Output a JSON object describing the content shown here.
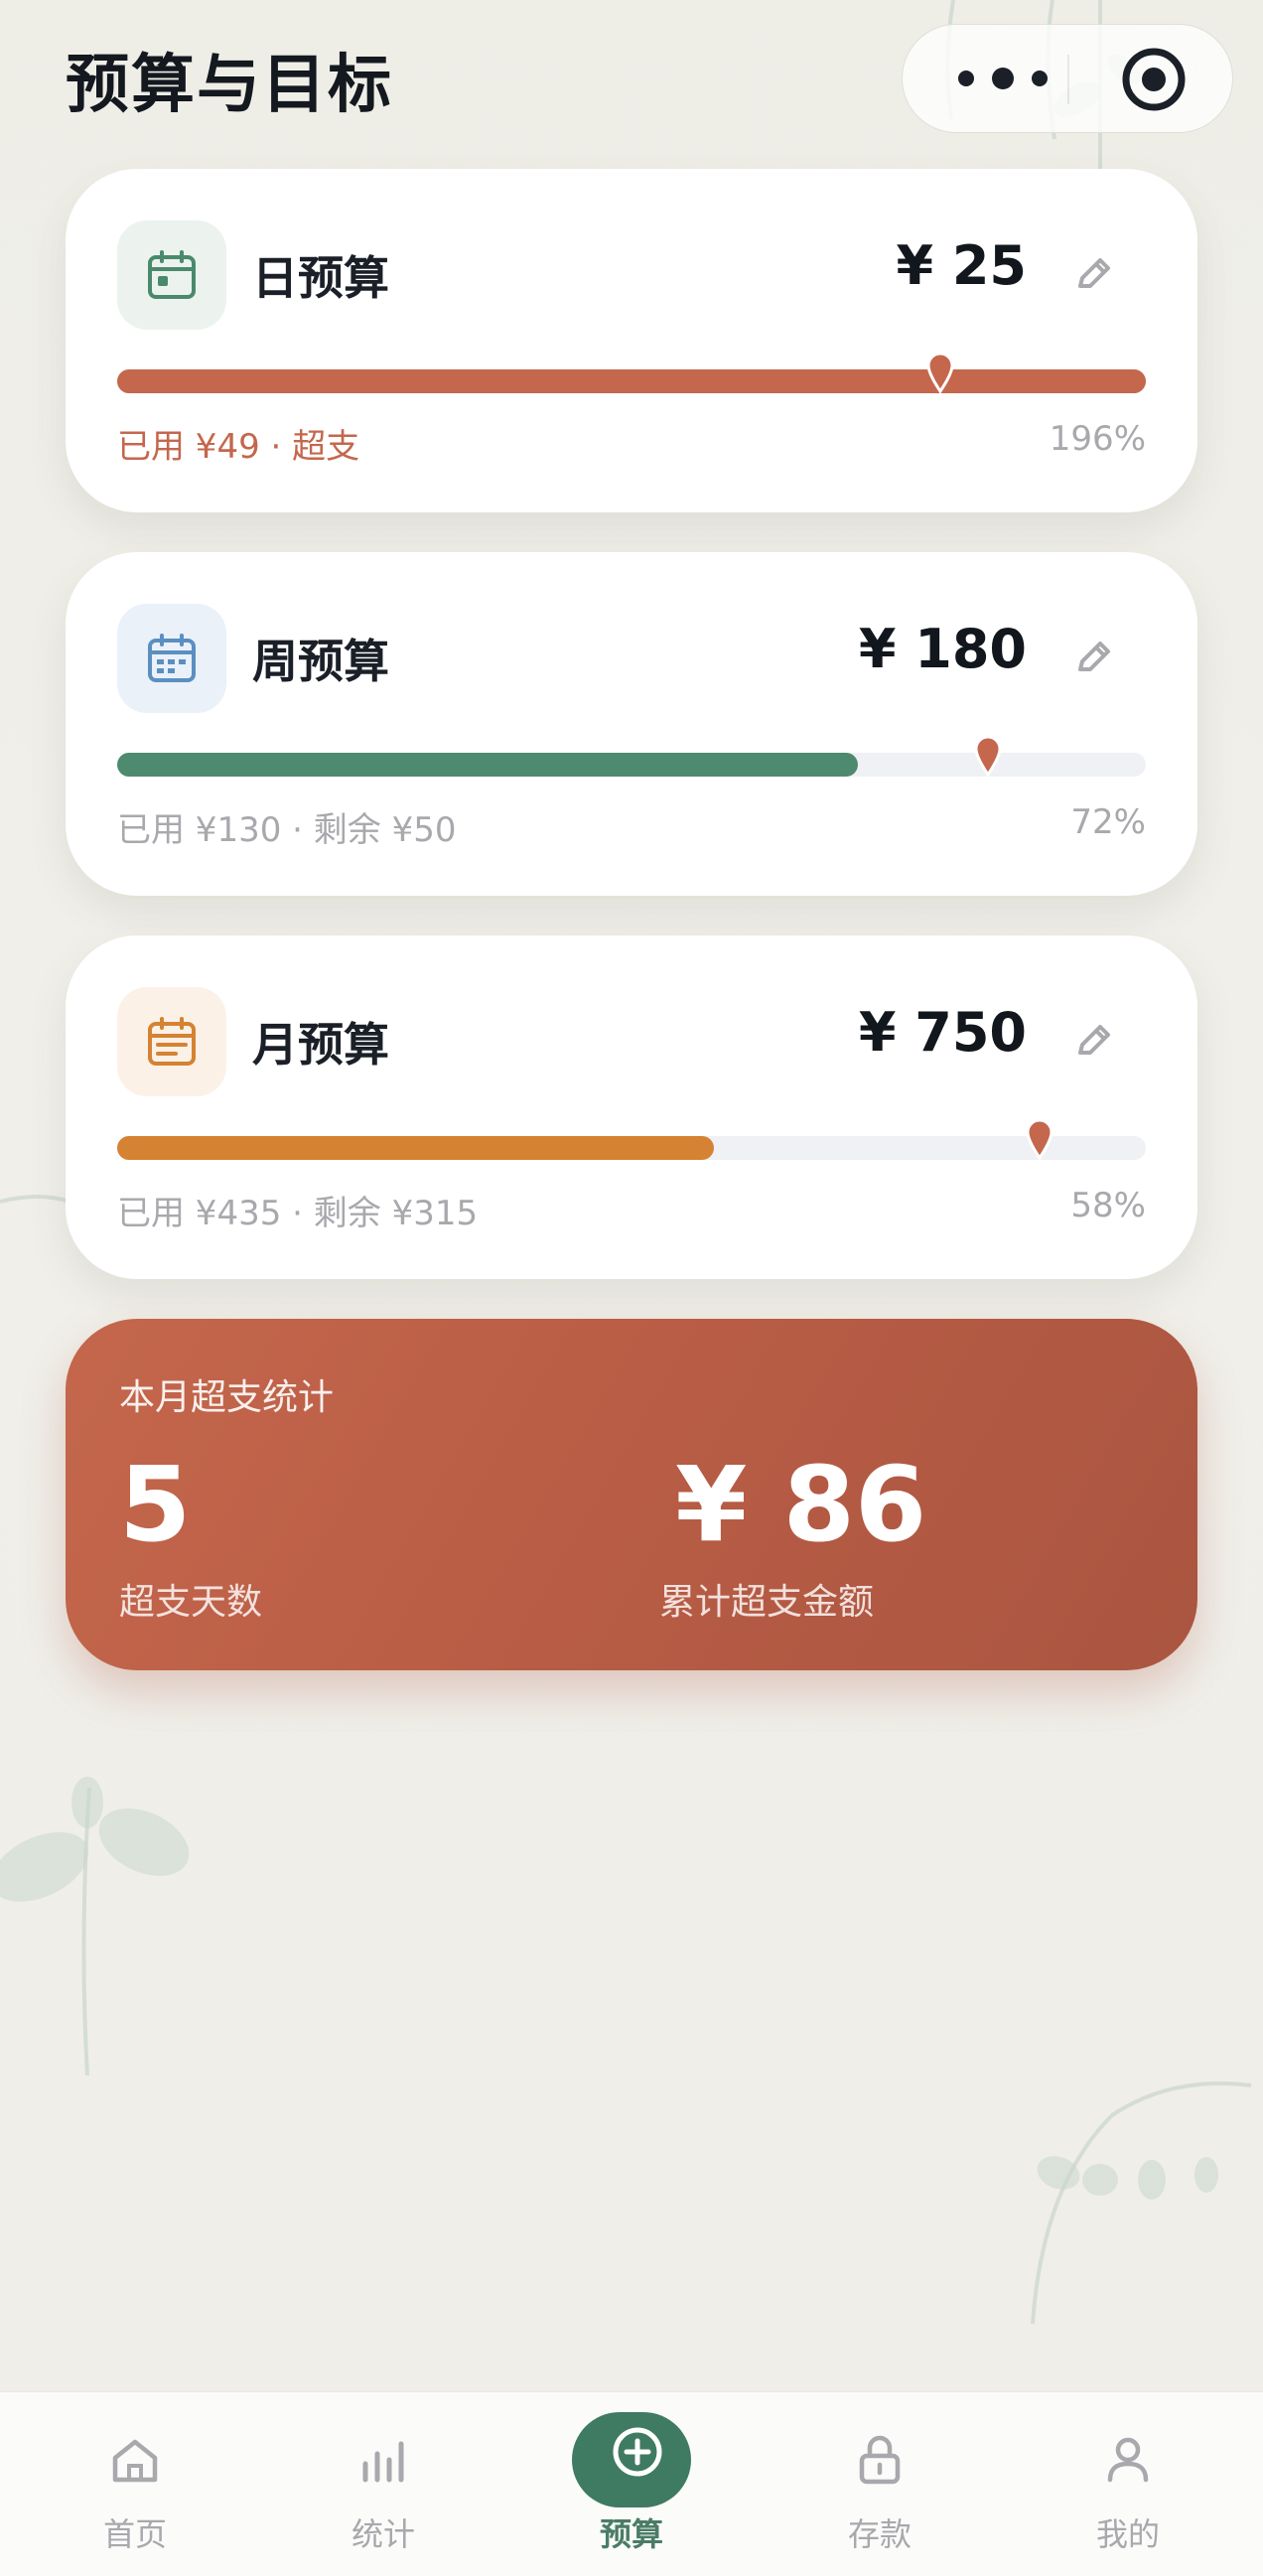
{
  "header": {
    "title": "预算与目标"
  },
  "budgets": [
    {
      "title": "日预算",
      "amount": "¥ 25",
      "used_text": "已用 ¥49 · 超支",
      "percent_text": "196%",
      "fill_fraction": 1.0,
      "marker_fraction": 0.8,
      "color": "#c4674c",
      "icon_bg": "#ecf3ee",
      "icon_color": "#4a8a6c",
      "over": true
    },
    {
      "title": "周预算",
      "amount": "¥ 180",
      "used_text": "已用 ¥130 · 剩余 ¥50",
      "percent_text": "72%",
      "fill_fraction": 0.72,
      "marker_fraction": 0.847,
      "color": "#4e8a6e",
      "icon_bg": "#eaf1f8",
      "icon_color": "#5b8fc2",
      "over": false
    },
    {
      "title": "月预算",
      "amount": "¥ 750",
      "used_text": "已用 ¥435 · 剩余 ¥315",
      "percent_text": "58%",
      "fill_fraction": 0.58,
      "marker_fraction": 0.897,
      "color": "#d58233",
      "icon_bg": "#fcf1e7",
      "icon_color": "#d58233",
      "over": false
    }
  ],
  "summary": {
    "title": "本月超支统计",
    "days_value": "5",
    "days_label": "超支天数",
    "amount_value": "¥ 86",
    "amount_label": "累计超支金额"
  },
  "tabs": [
    {
      "label": "首页",
      "icon": "home-icon",
      "active": false
    },
    {
      "label": "统计",
      "icon": "bar-chart-icon",
      "active": false
    },
    {
      "label": "预算",
      "icon": "plus-circle-icon",
      "active": true
    },
    {
      "label": "存款",
      "icon": "lock-icon",
      "active": false
    },
    {
      "label": "我的",
      "icon": "user-icon",
      "active": false
    }
  ],
  "colors": {
    "accent_green": "#3f7a62",
    "over_red": "#c4674c",
    "muted_text": "#a8a8ad"
  }
}
